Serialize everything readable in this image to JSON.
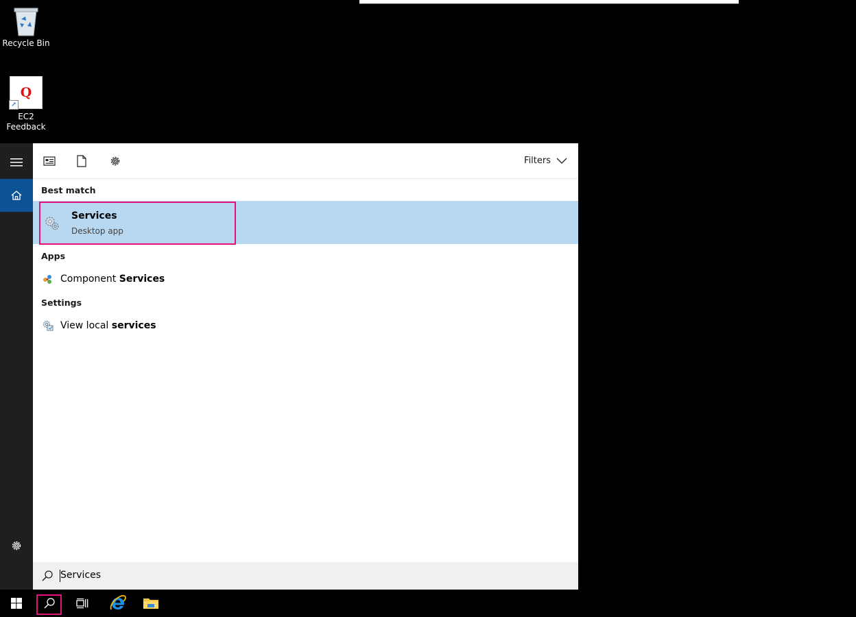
{
  "desktop": {
    "icons": [
      {
        "label": "Recycle Bin",
        "icon": "recycle-bin-icon"
      },
      {
        "label": "EC2\nFeedback",
        "icon": "ec2-feedback-icon",
        "glyph": "Q"
      }
    ]
  },
  "start_rail": {
    "items": [
      {
        "icon": "hamburger-menu-icon"
      },
      {
        "icon": "home-icon",
        "active": true
      },
      {
        "icon": "gear-icon"
      }
    ]
  },
  "search_panel": {
    "tabs": [
      {
        "icon": "apps-icon"
      },
      {
        "icon": "documents-icon"
      },
      {
        "icon": "settings-gear-icon"
      }
    ],
    "filters_label": "Filters",
    "best_match": {
      "header": "Best match",
      "title": "Services",
      "subtitle": "Desktop app"
    },
    "apps": {
      "header": "Apps",
      "items": [
        {
          "text_before": "Component ",
          "text_bold": "Services"
        }
      ]
    },
    "settings": {
      "header": "Settings",
      "items": [
        {
          "text_before": "View local ",
          "text_bold": "services"
        }
      ]
    },
    "search_input": {
      "value": "Services"
    }
  },
  "taskbar": {
    "items": [
      {
        "icon": "windows-start-icon"
      },
      {
        "icon": "search-icon"
      },
      {
        "icon": "task-view-icon"
      },
      {
        "icon": "internet-explorer-icon"
      },
      {
        "icon": "file-explorer-icon"
      }
    ]
  },
  "colors": {
    "accent": "#0b5394",
    "highlight": "#b8d8f2",
    "focus_outline": "#e5107a"
  }
}
